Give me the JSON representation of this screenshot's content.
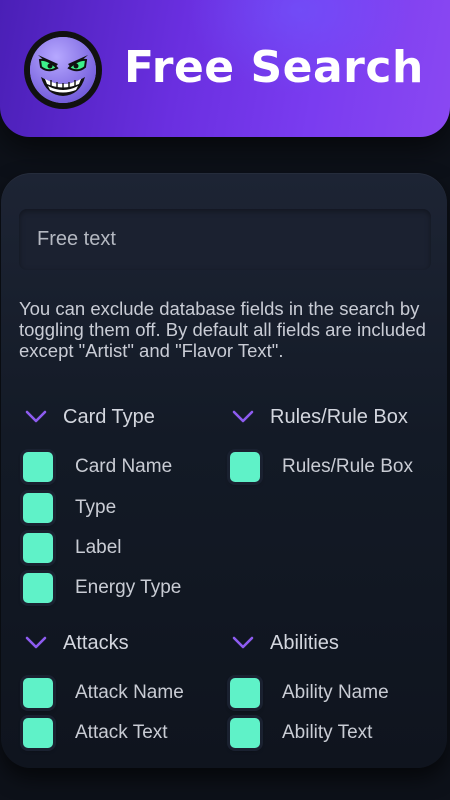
{
  "header": {
    "title": "Free Search",
    "logo_icon": "grinning-villain-face-icon"
  },
  "search": {
    "placeholder": "Free text",
    "value": ""
  },
  "description": "You can exclude database fields in the search by toggling them off. By default all fields are included except \"Artist\" and \"Flavor Text\".",
  "colors": {
    "accent": "#7b3ff0",
    "checkbox": "#5ff2c8",
    "chevron": "#8e5cf0"
  },
  "sections": {
    "card_type": {
      "label": "Card Type",
      "options": [
        {
          "label": "Card Name",
          "checked": true
        },
        {
          "label": "Type",
          "checked": true
        },
        {
          "label": "Label",
          "checked": true
        },
        {
          "label": "Energy Type",
          "checked": true
        }
      ]
    },
    "rules": {
      "label": "Rules/Rule Box",
      "options": [
        {
          "label": "Rules/Rule Box",
          "checked": true
        }
      ]
    },
    "attacks": {
      "label": "Attacks",
      "options": [
        {
          "label": "Attack Name",
          "checked": true
        },
        {
          "label": "Attack Text",
          "checked": true
        }
      ]
    },
    "abilities": {
      "label": "Abilities",
      "options": [
        {
          "label": "Ability Name",
          "checked": true
        },
        {
          "label": "Ability Text",
          "checked": true
        }
      ]
    }
  }
}
